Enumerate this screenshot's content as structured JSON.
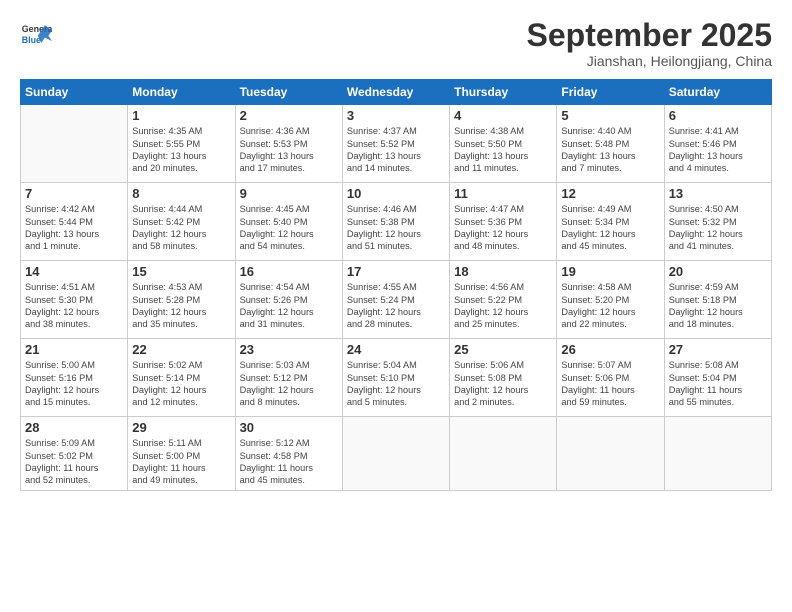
{
  "header": {
    "logo_general": "General",
    "logo_blue": "Blue",
    "month": "September 2025",
    "location": "Jianshan, Heilongjiang, China"
  },
  "weekdays": [
    "Sunday",
    "Monday",
    "Tuesday",
    "Wednesday",
    "Thursday",
    "Friday",
    "Saturday"
  ],
  "weeks": [
    [
      {
        "day": "",
        "info": ""
      },
      {
        "day": "1",
        "info": "Sunrise: 4:35 AM\nSunset: 5:55 PM\nDaylight: 13 hours\nand 20 minutes."
      },
      {
        "day": "2",
        "info": "Sunrise: 4:36 AM\nSunset: 5:53 PM\nDaylight: 13 hours\nand 17 minutes."
      },
      {
        "day": "3",
        "info": "Sunrise: 4:37 AM\nSunset: 5:52 PM\nDaylight: 13 hours\nand 14 minutes."
      },
      {
        "day": "4",
        "info": "Sunrise: 4:38 AM\nSunset: 5:50 PM\nDaylight: 13 hours\nand 11 minutes."
      },
      {
        "day": "5",
        "info": "Sunrise: 4:40 AM\nSunset: 5:48 PM\nDaylight: 13 hours\nand 7 minutes."
      },
      {
        "day": "6",
        "info": "Sunrise: 4:41 AM\nSunset: 5:46 PM\nDaylight: 13 hours\nand 4 minutes."
      }
    ],
    [
      {
        "day": "7",
        "info": "Sunrise: 4:42 AM\nSunset: 5:44 PM\nDaylight: 13 hours\nand 1 minute."
      },
      {
        "day": "8",
        "info": "Sunrise: 4:44 AM\nSunset: 5:42 PM\nDaylight: 12 hours\nand 58 minutes."
      },
      {
        "day": "9",
        "info": "Sunrise: 4:45 AM\nSunset: 5:40 PM\nDaylight: 12 hours\nand 54 minutes."
      },
      {
        "day": "10",
        "info": "Sunrise: 4:46 AM\nSunset: 5:38 PM\nDaylight: 12 hours\nand 51 minutes."
      },
      {
        "day": "11",
        "info": "Sunrise: 4:47 AM\nSunset: 5:36 PM\nDaylight: 12 hours\nand 48 minutes."
      },
      {
        "day": "12",
        "info": "Sunrise: 4:49 AM\nSunset: 5:34 PM\nDaylight: 12 hours\nand 45 minutes."
      },
      {
        "day": "13",
        "info": "Sunrise: 4:50 AM\nSunset: 5:32 PM\nDaylight: 12 hours\nand 41 minutes."
      }
    ],
    [
      {
        "day": "14",
        "info": "Sunrise: 4:51 AM\nSunset: 5:30 PM\nDaylight: 12 hours\nand 38 minutes."
      },
      {
        "day": "15",
        "info": "Sunrise: 4:53 AM\nSunset: 5:28 PM\nDaylight: 12 hours\nand 35 minutes."
      },
      {
        "day": "16",
        "info": "Sunrise: 4:54 AM\nSunset: 5:26 PM\nDaylight: 12 hours\nand 31 minutes."
      },
      {
        "day": "17",
        "info": "Sunrise: 4:55 AM\nSunset: 5:24 PM\nDaylight: 12 hours\nand 28 minutes."
      },
      {
        "day": "18",
        "info": "Sunrise: 4:56 AM\nSunset: 5:22 PM\nDaylight: 12 hours\nand 25 minutes."
      },
      {
        "day": "19",
        "info": "Sunrise: 4:58 AM\nSunset: 5:20 PM\nDaylight: 12 hours\nand 22 minutes."
      },
      {
        "day": "20",
        "info": "Sunrise: 4:59 AM\nSunset: 5:18 PM\nDaylight: 12 hours\nand 18 minutes."
      }
    ],
    [
      {
        "day": "21",
        "info": "Sunrise: 5:00 AM\nSunset: 5:16 PM\nDaylight: 12 hours\nand 15 minutes."
      },
      {
        "day": "22",
        "info": "Sunrise: 5:02 AM\nSunset: 5:14 PM\nDaylight: 12 hours\nand 12 minutes."
      },
      {
        "day": "23",
        "info": "Sunrise: 5:03 AM\nSunset: 5:12 PM\nDaylight: 12 hours\nand 8 minutes."
      },
      {
        "day": "24",
        "info": "Sunrise: 5:04 AM\nSunset: 5:10 PM\nDaylight: 12 hours\nand 5 minutes."
      },
      {
        "day": "25",
        "info": "Sunrise: 5:06 AM\nSunset: 5:08 PM\nDaylight: 12 hours\nand 2 minutes."
      },
      {
        "day": "26",
        "info": "Sunrise: 5:07 AM\nSunset: 5:06 PM\nDaylight: 11 hours\nand 59 minutes."
      },
      {
        "day": "27",
        "info": "Sunrise: 5:08 AM\nSunset: 5:04 PM\nDaylight: 11 hours\nand 55 minutes."
      }
    ],
    [
      {
        "day": "28",
        "info": "Sunrise: 5:09 AM\nSunset: 5:02 PM\nDaylight: 11 hours\nand 52 minutes."
      },
      {
        "day": "29",
        "info": "Sunrise: 5:11 AM\nSunset: 5:00 PM\nDaylight: 11 hours\nand 49 minutes."
      },
      {
        "day": "30",
        "info": "Sunrise: 5:12 AM\nSunset: 4:58 PM\nDaylight: 11 hours\nand 45 minutes."
      },
      {
        "day": "",
        "info": ""
      },
      {
        "day": "",
        "info": ""
      },
      {
        "day": "",
        "info": ""
      },
      {
        "day": "",
        "info": ""
      }
    ]
  ]
}
